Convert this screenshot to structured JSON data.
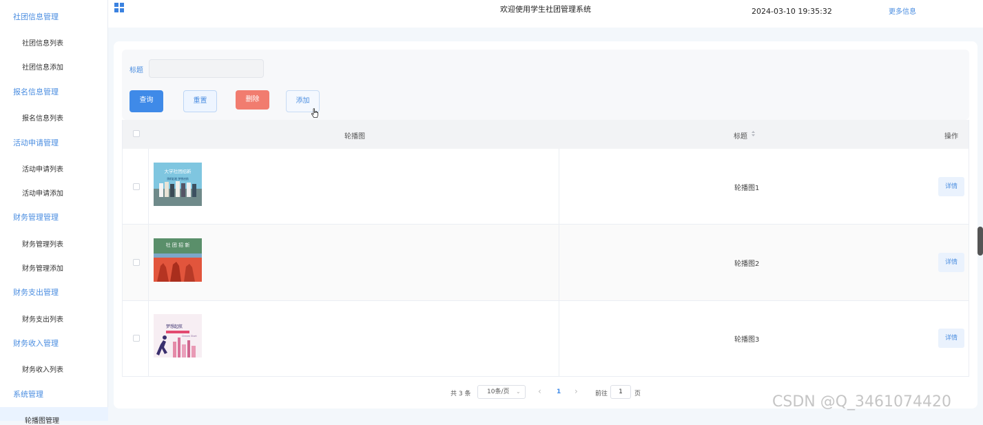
{
  "sidebar": {
    "groups": [
      {
        "label": "社团信息管理",
        "items": [
          "社团信息列表",
          "社团信息添加"
        ]
      },
      {
        "label": "报名信息管理",
        "items": [
          "报名信息列表"
        ]
      },
      {
        "label": "活动申请管理",
        "items": [
          "活动申请列表",
          "活动申请添加"
        ]
      },
      {
        "label": "财务管理管理",
        "items": [
          "财务管理列表",
          "财务管理添加"
        ]
      },
      {
        "label": "财务支出管理",
        "items": [
          "财务支出列表"
        ]
      },
      {
        "label": "财务收入管理",
        "items": [
          "财务收入列表"
        ]
      },
      {
        "label": "系统管理",
        "items": [
          "轮播图管理"
        ]
      }
    ]
  },
  "header": {
    "welcome": "欢迎使用学生社团管理系统",
    "datetime": "2024-03-10 19:35:32",
    "more": "更多信息"
  },
  "search": {
    "title_label": "标题",
    "title_value": "",
    "query_label": "查询",
    "reset_label": "重置",
    "delete_label": "删除",
    "add_label": "添加"
  },
  "table": {
    "columns": [
      "轮播图",
      "标题",
      "操作"
    ],
    "sort_icon": "sort-icon",
    "rows": [
      {
        "title": "轮播图1",
        "image_text": "大学社团招新",
        "image_sub": "扬帆起航 梦想启航",
        "action": "详情"
      },
      {
        "title": "轮播图2",
        "image_text": "社 团 招 新",
        "action": "详情"
      },
      {
        "title": "轮播图3",
        "image_text": "梦想起航",
        "image_sub": "Dream Start",
        "action": "详情"
      }
    ]
  },
  "pagination": {
    "total": "共 3 条",
    "page_size": "10条/页",
    "prev": "‹",
    "current": "1",
    "next": "›",
    "goto_label": "前往",
    "goto_value": "1",
    "page_suffix": "页"
  },
  "watermark": "CSDN @Q_3461074420",
  "colors": {
    "accent": "#3f8ae8",
    "danger": "#f17c6f",
    "link": "#4a8de0"
  }
}
